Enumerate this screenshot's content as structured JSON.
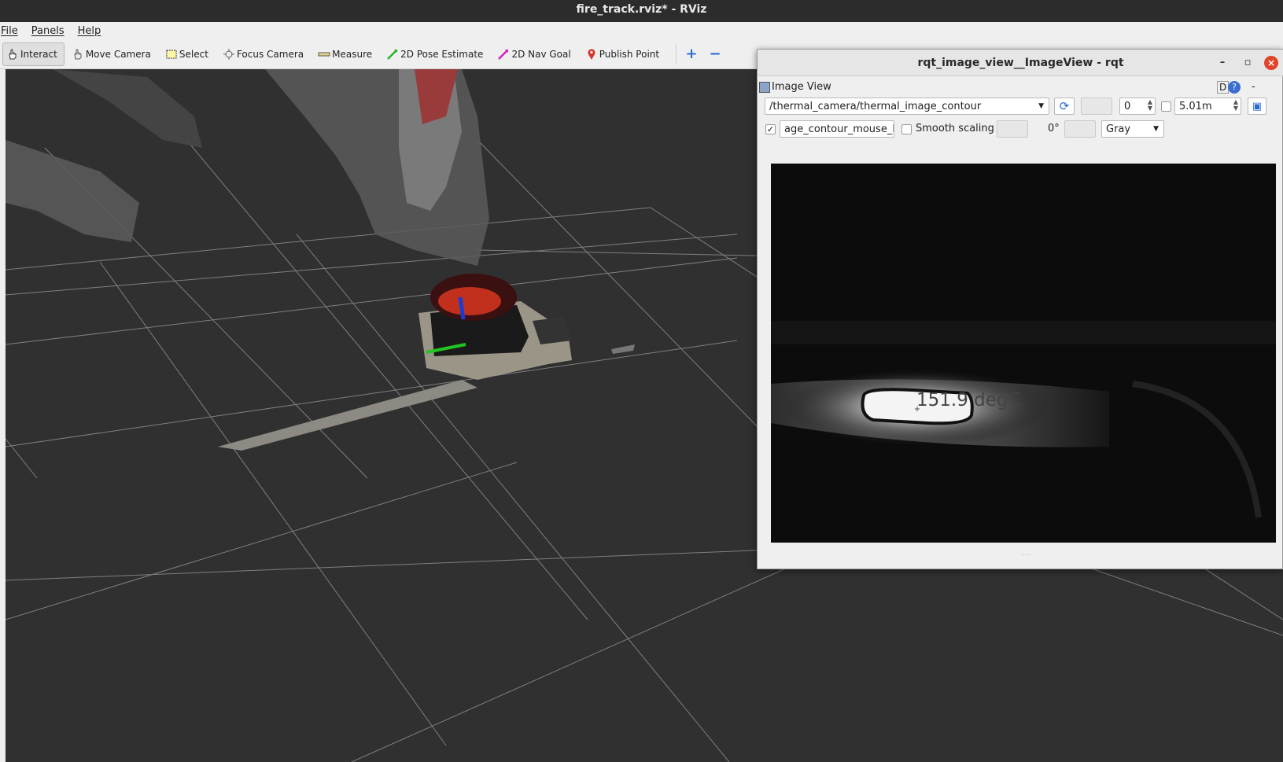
{
  "window": {
    "title": "fire_track.rviz* - RViz"
  },
  "menubar": {
    "items": [
      "File",
      "Panels",
      "Help"
    ]
  },
  "toolbar": {
    "tools": [
      {
        "label": "Interact",
        "icon": "hand-cursor-icon",
        "active": true
      },
      {
        "label": "Move Camera",
        "icon": "move-camera-icon",
        "active": false
      },
      {
        "label": "Select",
        "icon": "select-box-icon",
        "active": false
      },
      {
        "label": "Focus Camera",
        "icon": "focus-camera-icon",
        "active": false
      },
      {
        "label": "Measure",
        "icon": "ruler-icon",
        "active": false
      },
      {
        "label": "2D Pose Estimate",
        "icon": "green-arrow-icon",
        "active": false
      },
      {
        "label": "2D Nav Goal",
        "icon": "magenta-arrow-icon",
        "active": false
      },
      {
        "label": "Publish Point",
        "icon": "map-pin-icon",
        "active": false
      }
    ],
    "add_tool_icon": "plus-icon",
    "remove_tool_icon": "minus-icon"
  },
  "rqt": {
    "title": "rqt_image_view__ImageView - rqt",
    "panel_title": "Image View",
    "help_label": "D",
    "topic": "/thermal_camera/thermal_image_contour",
    "refresh_icon": "refresh-icon",
    "spin_value": "0",
    "max_range": "5.01m",
    "save_icon": "save-icon",
    "mouse_topic": "age_contour_mouse_left",
    "mouse_enabled": true,
    "smooth_label": "Smooth scaling",
    "smooth_enabled": false,
    "rotation": "0°",
    "colormap": "Gray",
    "temperature_overlay": "151.9 degC"
  },
  "colors": {
    "grid": "#7a7a7a",
    "background": "#303030",
    "close_button": "#e0452a",
    "fire": "#c0301d"
  }
}
